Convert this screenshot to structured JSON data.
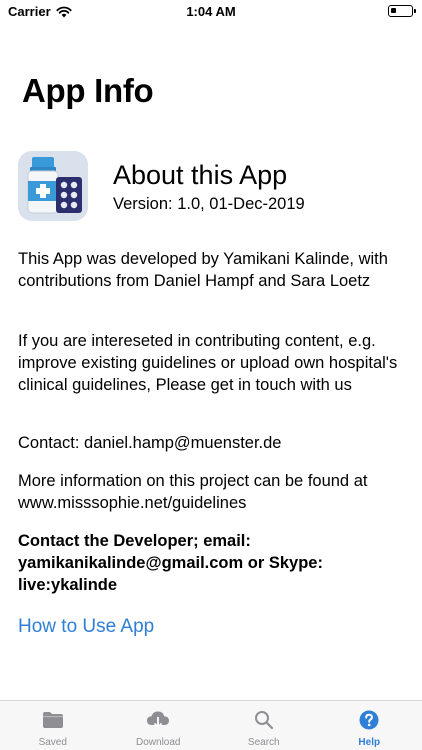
{
  "status_bar": {
    "carrier": "Carrier",
    "time": "1:04 AM"
  },
  "page": {
    "title": "App Info"
  },
  "about": {
    "icon": "medicine-app-icon",
    "title": "About this App",
    "version": "Version: 1.0,  01-Dec-2019"
  },
  "paragraphs": {
    "developed_by": "This App was developed by Yamikani Kalinde, with contributions from Daniel Hampf and Sara Loetz",
    "contributing": "If you are intereseted in contributing content, e.g. improve existing guidelines or upload own hospital's clinical guidelines, Please get in touch with us",
    "contact": "Contact: daniel.hamp@muenster.de",
    "more_info": "More information on this project can be found at www.misssophie.net/guidelines",
    "developer_contact": "Contact the Developer; email: yamikanikalinde@gmail.com or Skype: live:ykalinde"
  },
  "links": {
    "how_to_use": "How to Use App"
  },
  "tab_bar": {
    "items": [
      {
        "label": "Saved",
        "icon": "folder-icon"
      },
      {
        "label": "Download",
        "icon": "cloud-download-icon"
      },
      {
        "label": "Search",
        "icon": "search-icon"
      },
      {
        "label": "Help",
        "icon": "help-icon"
      }
    ],
    "active": "Help"
  },
  "colors": {
    "accent": "#2f7fd6",
    "inactive": "#8e8e93",
    "tab_bar_bg": "#f7f7f7"
  }
}
